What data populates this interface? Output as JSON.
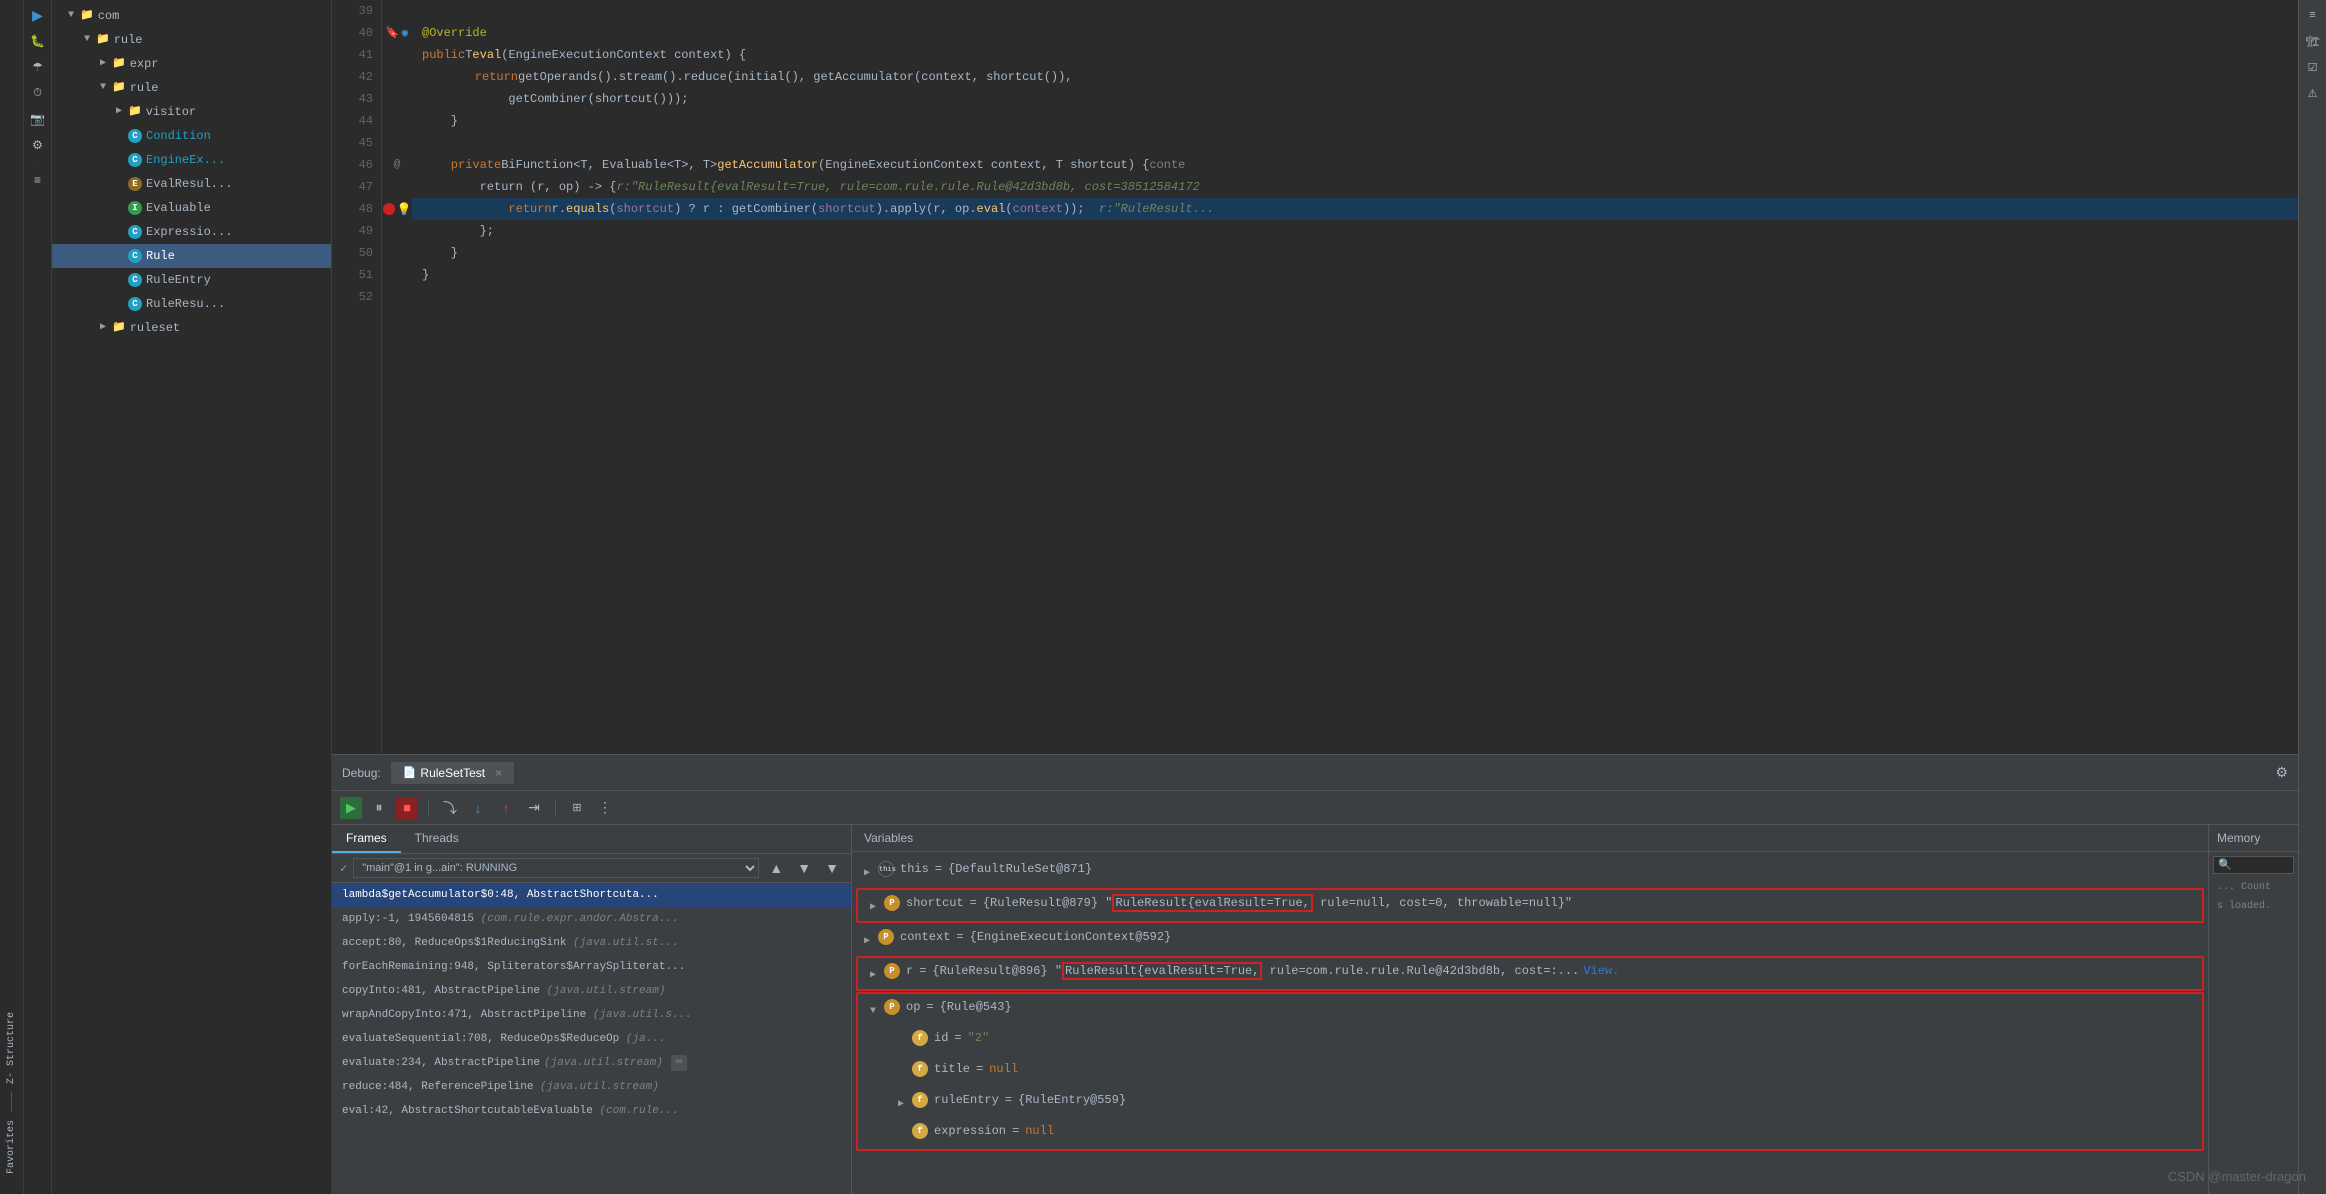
{
  "sidebar": {
    "items": [
      {
        "label": "com",
        "type": "folder",
        "indent": 1,
        "expanded": true
      },
      {
        "label": "rule",
        "type": "folder",
        "indent": 2,
        "expanded": true
      },
      {
        "label": "expr",
        "type": "folder",
        "indent": 3,
        "expanded": false
      },
      {
        "label": "rule",
        "type": "folder",
        "indent": 3,
        "expanded": true
      },
      {
        "label": "visitor",
        "type": "folder",
        "indent": 4,
        "expanded": false
      },
      {
        "label": "Condition",
        "type": "class-c",
        "indent": 4,
        "selected": false
      },
      {
        "label": "EngineEx...",
        "type": "class-c",
        "indent": 4,
        "selected": false
      },
      {
        "label": "EvalResul...",
        "type": "class-e",
        "indent": 4,
        "selected": false
      },
      {
        "label": "Evaluable",
        "type": "class-i",
        "indent": 4,
        "selected": false
      },
      {
        "label": "Expressio...",
        "type": "class-c",
        "indent": 4,
        "selected": false
      },
      {
        "label": "Rule",
        "type": "class-r",
        "indent": 4,
        "selected": true
      },
      {
        "label": "RuleEntry",
        "type": "class-c",
        "indent": 4,
        "selected": false
      },
      {
        "label": "RuleResu...",
        "type": "class-c",
        "indent": 4,
        "selected": false
      },
      {
        "label": "ruleset",
        "type": "folder",
        "indent": 3,
        "expanded": false
      }
    ]
  },
  "editor": {
    "lines": [
      {
        "num": 39,
        "content": "",
        "blank": true
      },
      {
        "num": 40,
        "content": "@Override",
        "type": "annotation"
      },
      {
        "num": 41,
        "content": "public T eval(EngineExecutionContext context) {",
        "type": "code"
      },
      {
        "num": 42,
        "content": "    return getOperands().stream().reduce(initial(), getAccumulator(context, shortcut()),",
        "type": "code"
      },
      {
        "num": 43,
        "content": "            getCombiner(shortcut()));",
        "type": "code"
      },
      {
        "num": 44,
        "content": "}",
        "type": "code"
      },
      {
        "num": 45,
        "content": "",
        "blank": true
      },
      {
        "num": 46,
        "content": "private BiFunction<T, Evaluable<T>, T> getAccumulator(EngineExecutionContext context, T shortcut) { conte",
        "type": "code",
        "at_sign": true
      },
      {
        "num": 47,
        "content": "    return (r, op) -> {  r: \"RuleResult{evalResult=True, rule=com.rule.rule.Rule@42d3bd8b, cost=38512584172",
        "type": "code"
      },
      {
        "num": 48,
        "content": "        return r.equals(shortcut) ? r : getCombiner(shortcut).apply(r, op.eval(context));  r: \"RuleResult...",
        "type": "code",
        "highlighted": true,
        "has_breakpoint": true
      },
      {
        "num": 49,
        "content": "    };",
        "type": "code"
      },
      {
        "num": 50,
        "content": "}",
        "type": "code"
      },
      {
        "num": 51,
        "content": "}",
        "type": "code"
      },
      {
        "num": 52,
        "content": "",
        "blank": true
      }
    ]
  },
  "debug": {
    "header": {
      "label": "Debug:",
      "tab_name": "RuleSetTest",
      "close": "×"
    },
    "toolbar_buttons": [
      "resume",
      "pause",
      "stop",
      "step_over",
      "step_into",
      "step_out",
      "run_to_cursor",
      "evaluate"
    ],
    "frames_panel": {
      "tabs": [
        "Frames",
        "Threads"
      ],
      "thread": "\"main\"@1 in g...ain\": RUNNING",
      "frames": [
        {
          "text": "lambda$getAccumulator$0:48, AbstractShortcuta...",
          "active": true
        },
        {
          "text": "apply:-1, 1945604815 (com.rule.expr.andor.Abstra...",
          "italic_part": "(com.rule.expr.andor.Abstra..."
        },
        {
          "text": "accept:80, ReduceOps$1ReducingSink (java.util.st...",
          "italic_part": "(java.util.st..."
        },
        {
          "text": "forEachRemaining:948, Spliterators$ArraySpliterat...",
          "italic_part": ""
        },
        {
          "text": "copyInto:481, AbstractPipeline (java.util.stream)",
          "italic_part": "(java.util.stream)"
        },
        {
          "text": "wrapAndCopyInto:471, AbstractPipeline (java.util.s...",
          "italic_part": "(java.util.s..."
        },
        {
          "text": "evaluateSequential:708, ReduceOps$ReduceOp (ja...",
          "italic_part": ""
        },
        {
          "text": "evaluate:234, AbstractPipeline (java.util.stream)",
          "italic_part": "(java.util.stream)"
        },
        {
          "text": "reduce:484, ReferencePipeline (java.util.stream)",
          "italic_part": "(java.util.stream)"
        },
        {
          "text": "eval:42, AbstractShortcutableEvaluable (com.rule...",
          "italic_part": "(com.rule..."
        }
      ]
    },
    "variables_panel": {
      "header": "Variables",
      "items": [
        {
          "type": "this_badge",
          "name": "this",
          "value": "= {DefaultRuleSet@871}",
          "indent": 0,
          "expandable": true
        },
        {
          "type": "badge_p",
          "name": "shortcut",
          "value_prefix": "= {RuleResult@879} \"",
          "value_highlighted": "RuleResult{evalResult=True,",
          "value_suffix": " rule=null, cost=0, throwable=null}\"",
          "indent": 0,
          "expandable": true,
          "outlined": true
        },
        {
          "type": "badge_p",
          "name": "context",
          "value": "= {EngineExecutionContext@592}",
          "indent": 0,
          "expandable": true
        },
        {
          "type": "badge_p",
          "name": "r",
          "value_prefix": "= {RuleResult@896} \"",
          "value_highlighted": "RuleResult{evalResult=True,",
          "value_suffix": " rule=com.rule.rule.Rule@42d3bd8b, cost=:...",
          "indent": 0,
          "expandable": true,
          "has_view": true,
          "outlined": true
        },
        {
          "type": "badge_p",
          "name": "op",
          "value": "= {Rule@543}",
          "indent": 0,
          "expandable": true,
          "expanded": true,
          "outlined_group": true
        },
        {
          "type": "badge_f",
          "name": "id",
          "value": "= \"2\"",
          "indent": 1,
          "expandable": false
        },
        {
          "type": "badge_f",
          "name": "title",
          "value": "= null",
          "indent": 1,
          "expandable": false
        },
        {
          "type": "badge_f",
          "name": "ruleEntry",
          "value": "= {RuleEntry@559}",
          "indent": 1,
          "expandable": true
        },
        {
          "type": "badge_f",
          "name": "expression",
          "value": "= null",
          "indent": 1,
          "expandable": false
        }
      ]
    },
    "memory_panel": {
      "header": "Memory",
      "count_label": "... Count"
    }
  },
  "zsidebar": {
    "labels": [
      "Z- Structure",
      "Favorites"
    ]
  },
  "watermark": "CSDN @master-dragon",
  "top_icons": {
    "settings": "⚙"
  }
}
